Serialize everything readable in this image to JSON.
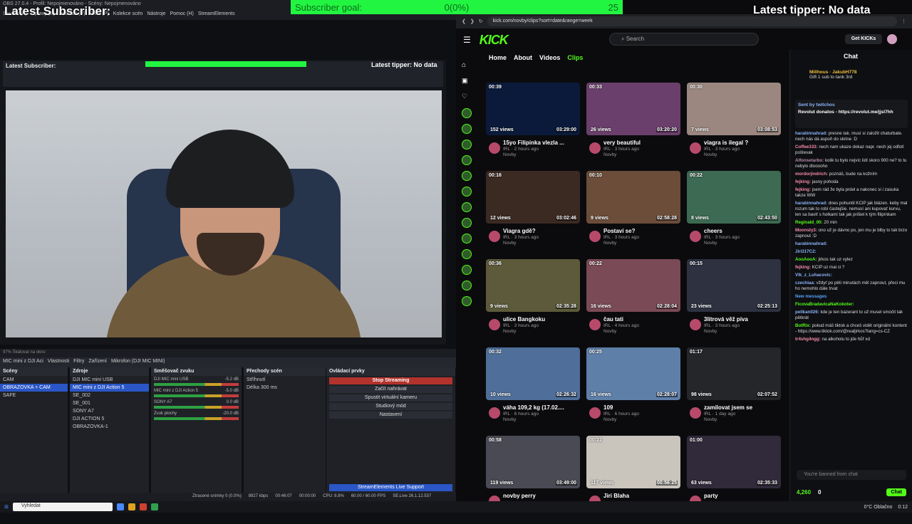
{
  "overlay": {
    "latest_subscriber": "Latest Subscriber:",
    "latest_tipper": "Latest tipper: No data",
    "goal_label": "Subscriber goal:",
    "goal_progress": "0(0%)",
    "goal_target": "25"
  },
  "obs": {
    "title": "OBS 27.0.4 - Profil: Nepojmenováno - Scény: Nepojmenováno",
    "menu": [
      "Soubor (F)",
      "Úpravy (E)",
      "Zobrazit (V)",
      "Profil (P)",
      "Kolekce scén",
      "Nástroje",
      "Pomoc (H)",
      "StreamElements"
    ],
    "mini_tipper": "Latest tipper: No data",
    "mini_sub": "Latest Subscriber:",
    "strip_text": "97%  Škálovat na okno",
    "source_toolbar": [
      "MIC mini z DJI Aci",
      "Vlastnosti",
      "Filtry",
      "Zařízení",
      "Mikrofon (DJI MIC MINI)"
    ],
    "docks": {
      "scenes_title": "Scény",
      "scenes": [
        "CAM",
        "OBRAZOVKA + CAM",
        "SAFE"
      ],
      "sources_title": "Zdroje",
      "sources": [
        "DJI MIC mini USB",
        "MIC mini z DJI Action 5",
        "SE_002",
        "SE_001",
        "SONY A7",
        "DJI ACTION 5",
        "OBRAZOVKA-1"
      ],
      "mixer_title": "Směšovač zvuku",
      "mixer": [
        {
          "name": "DJI MIC mini USB",
          "db": "-5.2 dB"
        },
        {
          "name": "MIC mini z DJI Action 5",
          "db": "-5.0 dB"
        },
        {
          "name": "SONY A7",
          "db": "0.0 dB"
        },
        {
          "name": "Zvuk plochy",
          "db": "-20.0 dB"
        }
      ],
      "transitions_title": "Přechody scén",
      "transition": "Stříhnutí",
      "duration_label": "Délka",
      "duration_value": "300 ms",
      "controls_title": "Ovládací prvky",
      "controls": [
        "Stop Streaming",
        "Začít nahrávat",
        "Spustit virtuální kameru",
        "Studiový mód",
        "Nastavení"
      ],
      "se_support": "StreamElements Live Support"
    },
    "statusbar": [
      "Ztracené snímky 0 (0.0%)",
      "8927 kbps",
      "00:46:07",
      "00:00:00",
      "CPU: 8.8%",
      "60.00 / 60.00 FPS",
      "SE.Live 26.1.12.537"
    ]
  },
  "browser": {
    "url": "kick.com/novby/clips?sort=date&range=week",
    "logo": "KICK",
    "search_placeholder": "Search",
    "get_kicks": "Get KICKs",
    "nav": [
      "Home",
      "About",
      "Videos",
      "Clips"
    ],
    "clips": [
      {
        "dur": "00:39",
        "views": "152 views",
        "ts": "03:29:00",
        "title": "15yo Filipinka vlezla ...",
        "meta": "IRL · 2 hours ago",
        "ch": "Novby",
        "color": "#0b1a3a"
      },
      {
        "dur": "00:33",
        "views": "26 views",
        "ts": "03:20:20",
        "title": "very beautiful",
        "meta": "IRL · 3 hours ago",
        "ch": "Novby",
        "color": "#6a3f6b"
      },
      {
        "dur": "00:30",
        "views": "7 views",
        "ts": "03:08:53",
        "title": "viagra is ilegal ?",
        "meta": "IRL · 3 hours ago",
        "ch": "Novby",
        "color": "#9b8780"
      },
      {
        "dur": "00:16",
        "views": "12 views",
        "ts": "03:02:46",
        "title": "Viagra gdě?",
        "meta": "IRL · 3 hours ago",
        "ch": "Novby",
        "color": "#3a2a22"
      },
      {
        "dur": "00:10",
        "views": "9 views",
        "ts": "02:58:28",
        "title": "Postaví se?",
        "meta": "IRL · 3 hours ago",
        "ch": "Novby",
        "color": "#6b4d3a"
      },
      {
        "dur": "00:22",
        "views": "8 views",
        "ts": "02:43:50",
        "title": "cheers",
        "meta": "IRL · 3 hours ago",
        "ch": "Novby",
        "color": "#3d6a52"
      },
      {
        "dur": "00:36",
        "views": "9 views",
        "ts": "02:35:28",
        "title": "ulice Bangkoku",
        "meta": "IRL · 3 hours ago",
        "ch": "Novby",
        "color": "#5c5a3a"
      },
      {
        "dur": "00:22",
        "views": "16 views",
        "ts": "02:28:04",
        "title": "čau tati",
        "meta": "IRL · 4 hours ago",
        "ch": "Novby",
        "color": "#7a4a56"
      },
      {
        "dur": "00:15",
        "views": "23 views",
        "ts": "02:25:13",
        "title": "3litrová věž piva",
        "meta": "IRL · 3 hours ago",
        "ch": "Novby",
        "color": "#2d3140"
      },
      {
        "dur": "00:32",
        "views": "10 views",
        "ts": "02:26:32",
        "title": "váha 109,2 kg (17.02....",
        "meta": "IRL · 6 hours ago",
        "ch": "Novby",
        "color": "#4f6f9a"
      },
      {
        "dur": "00:25",
        "views": "16 views",
        "ts": "02:28:07",
        "title": "109",
        "meta": "IRL · 6 hours ago",
        "ch": "Novby",
        "color": "#5e7fa8"
      },
      {
        "dur": "01:17",
        "views": "98 views",
        "ts": "02:07:52",
        "title": "zamilovat jsem se",
        "meta": "IRL · 1 day ago",
        "ch": "Novby",
        "color": "#24262a"
      },
      {
        "dur": "00:58",
        "views": "119 views",
        "ts": "03:49:00",
        "title": "novby perry",
        "meta": "",
        "ch": "",
        "color": "#4a4a55"
      },
      {
        "dur": "00:22",
        "views": "117 views",
        "ts": "00:56:25",
        "title": "Jiri Blaha",
        "meta": "",
        "ch": "",
        "color": "#c9c4bc"
      },
      {
        "dur": "01:00",
        "views": "63 views",
        "ts": "02:35:33",
        "title": "party",
        "meta": "",
        "ch": "",
        "color": "#302a3a"
      }
    ]
  },
  "chat": {
    "title": "Chat",
    "gift_users": "Millhous · JakubH778",
    "gift_text": "Gift 1 sub to tank 3rd",
    "pinned_by": "Sent by twitchos",
    "pinned_msg": "Revolut donatos - https://revolut.me/jjsl7hh",
    "messages": [
      {
        "user": "harabinnahrad:",
        "text": "presne tak. musí si založit chaturbate. nech nás dá aspoň do skrine :D",
        "color": "#8ab4f8"
      },
      {
        "user": "Coffee333:",
        "text": "nech nam ukaze dokaz napr. nech jej odfotí poštevak",
        "color": "#f38ba8"
      },
      {
        "user": "Alfonsetarbo:",
        "text": "kolik tu bylo nejvíc lidí skoro 900 ne? to tu nebylo dlooooho",
        "color": "#b48ead"
      },
      {
        "user": "mordorjindrich:",
        "text": "poznáš, bude na kožním",
        "color": "#f38ba8"
      },
      {
        "user": "fejking:",
        "text": "jasny pohoda",
        "color": "#f38ba8"
      },
      {
        "user": "fejking:",
        "text": "jsem rád že byla prdel a nakonec si i zasuka takze WW",
        "color": "#f38ba8"
      },
      {
        "user": "harabinnahrad:",
        "text": "dnes pohuntil KCIP jak blázen. keby mal rozum tak to robí častejšie. nemusí ani kupovať kurvu, len sa baviť s holkami tak jak prišiel k tým filipínkam",
        "color": "#8ab4f8"
      },
      {
        "user": "Reginald_00:",
        "text": "20 min",
        "color": "#53fc18"
      },
      {
        "user": "Moonsty3:",
        "text": "ono už je dávno po, jen mu je blby to tak brzo zapnout :D",
        "color": "#f38ba8"
      },
      {
        "user": "harabinnahrad:",
        "text": "",
        "color": "#8ab4f8"
      },
      {
        "user": "Jiri317C2:",
        "text": "",
        "color": "#8ab4f8"
      },
      {
        "user": "AooAooA:",
        "text": "jirkos tak uz vylez",
        "color": "#53fc18"
      },
      {
        "user": "fejking:",
        "text": "KCIP uz mai ci ?",
        "color": "#f38ba8"
      },
      {
        "user": "Vlk_z_Luhacovic:",
        "text": "",
        "color": "#8ab4f8"
      },
      {
        "user": "czechiaa:",
        "text": "vždyť po pěti minutách měl zapnout, přeci mu ho nemohlo dále trvat",
        "color": "#8ab4f8"
      },
      {
        "user": "New messages",
        "text": "",
        "color": "#53a0f8"
      },
      {
        "user": "FicovaBradavicaNaKokoter:",
        "text": "",
        "color": "#53fc18"
      },
      {
        "user": "pelikan026:",
        "text": "kde je ten bazerant to už musel smočit tak pětkrát",
        "color": "#8ab4f8"
      },
      {
        "user": "BotRix:",
        "text": "pokud máš tiktok a chceš vidět originální kontent - https://www.tiktok.com/@realjirkos?lang=cs-CZ",
        "color": "#53fc18"
      },
      {
        "user": "tr4shg4ngg:",
        "text": "na alkoholu to jde hůř xd",
        "color": "#f38ba8"
      }
    ],
    "banned": "You're banned from chat",
    "kicks": "4,260",
    "count": "0",
    "button": "Chat"
  },
  "taskbar": {
    "search": "Vyhledat",
    "weather": "0°C Oblačno",
    "time": "0:12"
  }
}
